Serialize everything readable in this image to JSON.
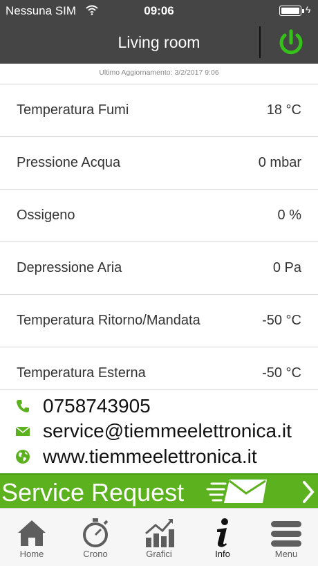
{
  "status_bar": {
    "carrier": "Nessuna SIM",
    "time": "09:06"
  },
  "header": {
    "title": "Living room"
  },
  "last_update": "Ultimo Aggiornamento: 3/2/2017 9:06",
  "rows": [
    {
      "label": "Temperatura Fumi",
      "value": "18 °C"
    },
    {
      "label": "Pressione Acqua",
      "value": "0 mbar"
    },
    {
      "label": "Ossigeno",
      "value": "0 %"
    },
    {
      "label": "Depressione Aria",
      "value": "0 Pa"
    },
    {
      "label": "Temperatura Ritorno/Mandata",
      "value": "-50 °C"
    },
    {
      "label": "Temperatura Esterna",
      "value": "-50 °C"
    }
  ],
  "contacts": {
    "phone": "0758743905",
    "email": "service@tiemmeelettronica.it",
    "website": "www.tiemmeelettronica.it"
  },
  "service_request": {
    "label": "Service Request"
  },
  "tabs": [
    {
      "label": "Home",
      "icon": "home-icon"
    },
    {
      "label": "Crono",
      "icon": "stopwatch-icon"
    },
    {
      "label": "Grafici",
      "icon": "chart-icon"
    },
    {
      "label": "Info",
      "icon": "info-icon"
    },
    {
      "label": "Menu",
      "icon": "menu-icon"
    }
  ],
  "colors": {
    "header_bg": "#454545",
    "accent_green": "#5cb21e",
    "power_green": "#35c11a"
  }
}
